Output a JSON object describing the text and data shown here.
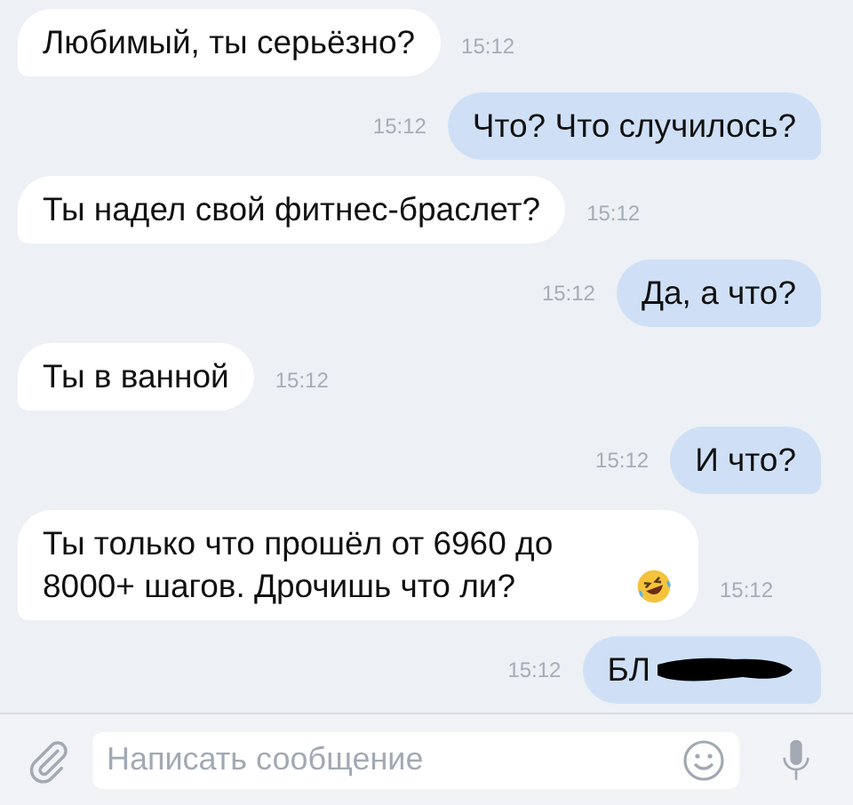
{
  "messages": [
    {
      "outgoing": false,
      "text": "Любимый, ты серьёзно?",
      "time": "15:12"
    },
    {
      "outgoing": true,
      "text": "Что? Что случилось?",
      "time": "15:12"
    },
    {
      "outgoing": false,
      "text": "Ты надел свой фитнес-браслет?",
      "time": "15:12"
    },
    {
      "outgoing": true,
      "text": "Да, а что?",
      "time": "15:12"
    },
    {
      "outgoing": false,
      "text": "Ты в ванной",
      "time": "15:12"
    },
    {
      "outgoing": true,
      "text": "И что?",
      "time": "15:12"
    },
    {
      "outgoing": false,
      "text": "Ты только что прошёл от 6960 до 8000+ шагов. Дрочишь что ли?",
      "time": "15:12",
      "emoji": true
    },
    {
      "outgoing": true,
      "text": "БЛ",
      "time": "15:12",
      "redacted": true
    }
  ],
  "composer": {
    "placeholder": "Написать сообщение"
  }
}
